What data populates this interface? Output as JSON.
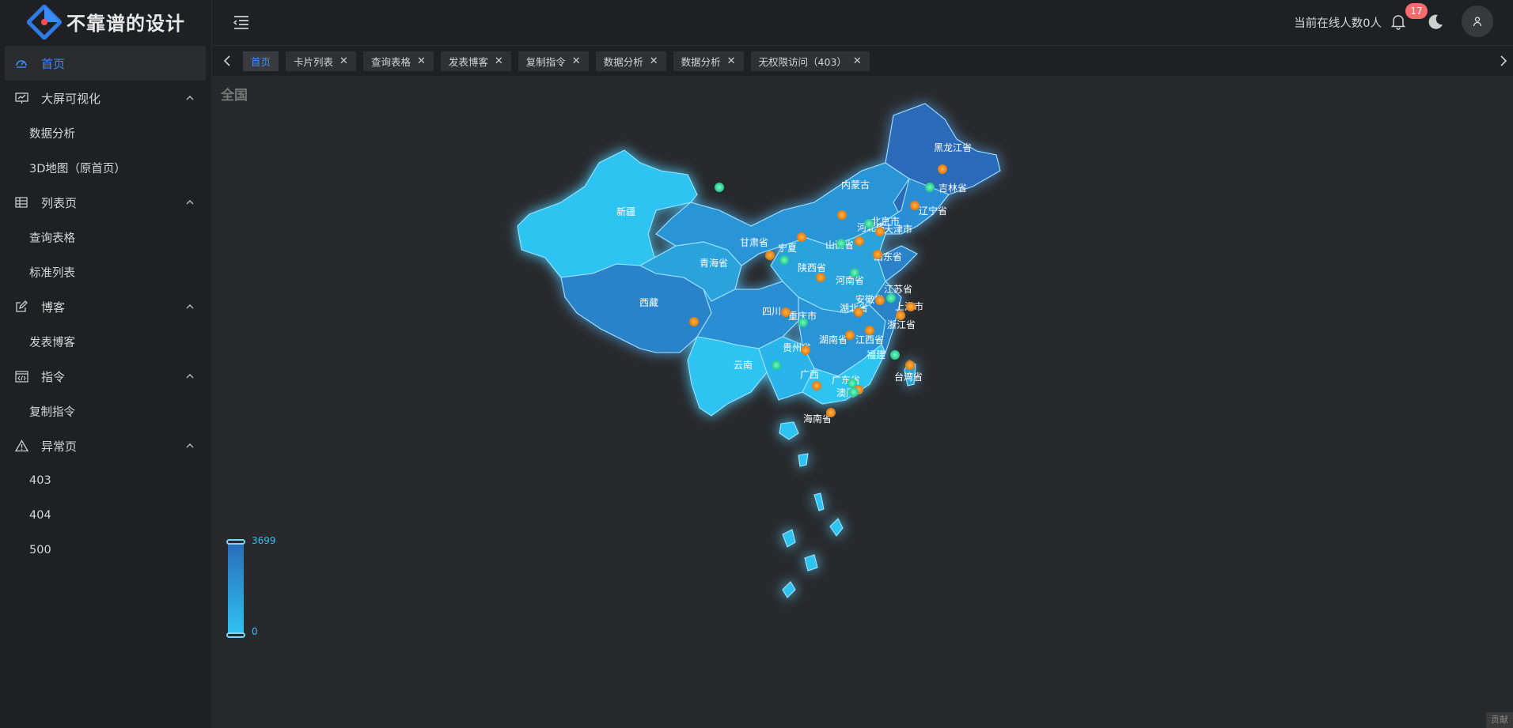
{
  "app": {
    "logo_text": "不靠谱的设计",
    "brand_color": "#3a8cff"
  },
  "sidebar": {
    "items": [
      {
        "label": "首页",
        "icon": "dashboard-icon",
        "level": "top",
        "active": true
      },
      {
        "label": "大屏可视化",
        "icon": "monitor-chart-icon",
        "level": "top",
        "expandable": true
      },
      {
        "label": "数据分析",
        "level": "sub"
      },
      {
        "label": "3D地图（原首页）",
        "level": "sub"
      },
      {
        "label": "列表页",
        "icon": "table-icon",
        "level": "top",
        "expandable": true
      },
      {
        "label": "查询表格",
        "level": "sub"
      },
      {
        "label": "标准列表",
        "level": "sub"
      },
      {
        "label": "博客",
        "icon": "edit-icon",
        "level": "top",
        "expandable": true
      },
      {
        "label": "发表博客",
        "level": "sub"
      },
      {
        "label": "指令",
        "icon": "code-window-icon",
        "level": "top",
        "expandable": true
      },
      {
        "label": "复制指令",
        "level": "sub"
      },
      {
        "label": "异常页",
        "icon": "warning-icon",
        "level": "top",
        "expandable": true
      },
      {
        "label": "403",
        "level": "sub"
      },
      {
        "label": "404",
        "level": "sub"
      },
      {
        "label": "500",
        "level": "sub"
      }
    ]
  },
  "header": {
    "online_text": "当前在线人数0人",
    "notification_count": "17"
  },
  "tabs": [
    {
      "label": "首页",
      "active": true,
      "closable": false
    },
    {
      "label": "卡片列表",
      "closable": true
    },
    {
      "label": "查询表格",
      "closable": true
    },
    {
      "label": "发表博客",
      "closable": true
    },
    {
      "label": "复制指令",
      "closable": true
    },
    {
      "label": "数据分析",
      "closable": true
    },
    {
      "label": "数据分析",
      "closable": true
    },
    {
      "label": "无权限访问（403）",
      "closable": true
    }
  ],
  "map": {
    "region_title": "全国",
    "legend": {
      "max": "3699",
      "min": "0"
    },
    "corner_tag": "贡献",
    "provinces": [
      {
        "name": "黑龙江省"
      },
      {
        "name": "吉林省"
      },
      {
        "name": "辽宁省"
      },
      {
        "name": "内蒙古"
      },
      {
        "name": "北京市"
      },
      {
        "name": "天津市"
      },
      {
        "name": "河北省"
      },
      {
        "name": "山西省"
      },
      {
        "name": "山东省"
      },
      {
        "name": "新疆"
      },
      {
        "name": "甘肃省"
      },
      {
        "name": "宁夏"
      },
      {
        "name": "青海省"
      },
      {
        "name": "陕西省"
      },
      {
        "name": "河南省"
      },
      {
        "name": "江苏省"
      },
      {
        "name": "安徽省"
      },
      {
        "name": "上海市"
      },
      {
        "name": "西藏"
      },
      {
        "name": "四川"
      },
      {
        "name": "湖北省"
      },
      {
        "name": "重庆市"
      },
      {
        "name": "浙江省"
      },
      {
        "name": "湖南省"
      },
      {
        "name": "江西省"
      },
      {
        "name": "贵州省"
      },
      {
        "name": "福建"
      },
      {
        "name": "云南"
      },
      {
        "name": "台湾省"
      },
      {
        "name": "广西"
      },
      {
        "name": "广东省"
      },
      {
        "name": "澳门"
      },
      {
        "name": "海南省"
      }
    ],
    "colors": {
      "fill_light": "#2ec4f2",
      "fill_dark": "#2a6bb8",
      "point_orange": "#f08a1a",
      "point_green": "#2fd69a"
    }
  }
}
